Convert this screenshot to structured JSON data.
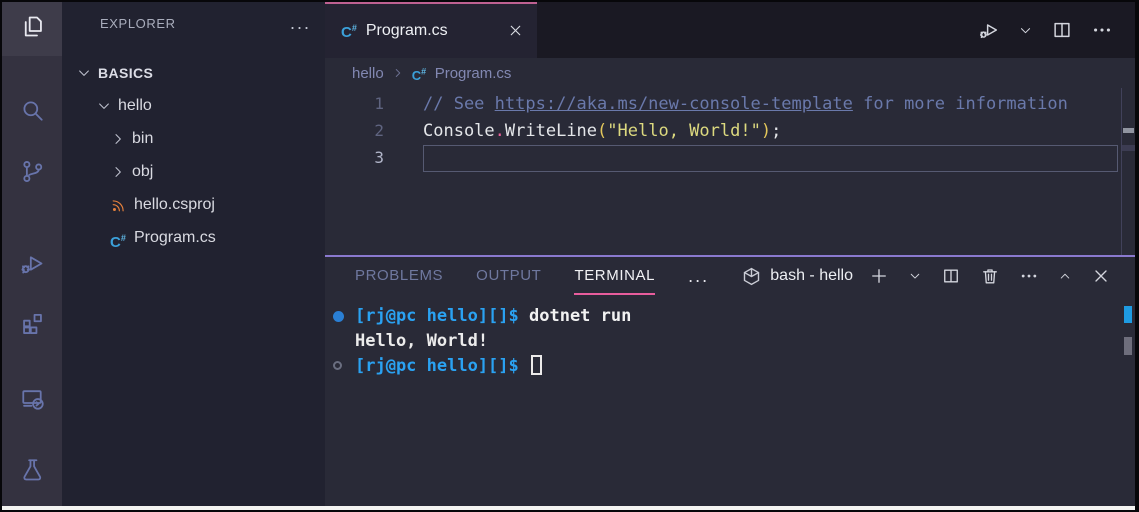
{
  "activity_bar": {
    "items": [
      {
        "name": "explorer",
        "icon": "files",
        "active": true
      },
      {
        "name": "search",
        "icon": "search",
        "active": false
      },
      {
        "name": "source-control",
        "icon": "git",
        "active": false
      },
      {
        "name": "run-and-debug",
        "icon": "debug",
        "active": false
      },
      {
        "name": "extensions",
        "icon": "extensions",
        "active": false
      },
      {
        "name": "remote-explorer",
        "icon": "remote",
        "active": false
      },
      {
        "name": "testing",
        "icon": "beaker",
        "active": false
      }
    ]
  },
  "sidebar": {
    "header": "EXPLORER",
    "more_icon": "...",
    "tree": [
      {
        "label": "BASICS",
        "icon": "chevron-down",
        "level": 0,
        "root": true
      },
      {
        "label": "hello",
        "icon": "chevron-down",
        "level": 1
      },
      {
        "label": "bin",
        "icon": "chevron-right",
        "level": 2
      },
      {
        "label": "obj",
        "icon": "chevron-right",
        "level": 2
      },
      {
        "label": "hello.csproj",
        "icon": "rss",
        "level": 2
      },
      {
        "label": "Program.cs",
        "icon": "csharp",
        "level": 2
      }
    ]
  },
  "editor": {
    "tab": {
      "label": "Program.cs",
      "icon": "csharp"
    },
    "actions": [
      {
        "name": "run-or-debug",
        "icon": "debug"
      },
      {
        "name": "run-dropdown",
        "icon": "chevron-down",
        "small": true
      },
      {
        "name": "split-editor",
        "icon": "split"
      },
      {
        "name": "more-actions",
        "icon": "ellipsis"
      }
    ],
    "breadcrumb": {
      "folder": "hello",
      "file": "Program.cs",
      "file_icon": "csharp"
    },
    "lines": [
      {
        "num": "1",
        "tokens": [
          {
            "text": "// See ",
            "style": "comment"
          },
          {
            "text": "https://aka.ms/new-console-template",
            "style": "comment-link"
          },
          {
            "text": " for more information",
            "style": "comment"
          }
        ]
      },
      {
        "num": "2",
        "tokens": [
          {
            "text": "Console",
            "style": "plain"
          },
          {
            "text": ".",
            "style": "accent-dot"
          },
          {
            "text": "WriteLine",
            "style": "plain"
          },
          {
            "text": "(",
            "style": "paren"
          },
          {
            "text": "\"Hello, World!\"",
            "style": "string"
          },
          {
            "text": ")",
            "style": "paren"
          },
          {
            "text": ";",
            "style": "plain"
          }
        ]
      },
      {
        "num": "3",
        "tokens": [],
        "current": true
      }
    ]
  },
  "panel": {
    "tabs": [
      {
        "label": "PROBLEMS",
        "active": false
      },
      {
        "label": "OUTPUT",
        "active": false
      },
      {
        "label": "TERMINAL",
        "active": true
      }
    ],
    "more_icon": "...",
    "terminal_label": "bash - hello",
    "actions": [
      {
        "name": "new-terminal",
        "icon": "plus"
      },
      {
        "name": "terminal-dropdown",
        "icon": "chevron-down",
        "small": true
      },
      {
        "name": "split-terminal",
        "icon": "split"
      },
      {
        "name": "kill-terminal",
        "icon": "trash"
      },
      {
        "name": "more-actions",
        "icon": "ellipsis"
      },
      {
        "name": "maximize-panel",
        "icon": "chevron-up",
        "small": true
      },
      {
        "name": "close-panel",
        "icon": "close"
      }
    ],
    "terminal_lines": [
      {
        "decoration": "success",
        "tokens": [
          {
            "text": "[rj@pc hello][]$ ",
            "style": "prompt"
          },
          {
            "text": "dotnet run",
            "style": "command"
          }
        ]
      },
      {
        "decoration": "none",
        "tokens": [
          {
            "text": "Hello, World!",
            "style": "output"
          }
        ]
      },
      {
        "decoration": "pending",
        "cursor": true,
        "tokens": [
          {
            "text": "[rj@pc hello][]$ ",
            "style": "prompt"
          }
        ]
      }
    ]
  },
  "colors": {
    "activity_bar_bg": "#343240",
    "sidebar_bg": "#212230",
    "editor_bg": "#292a37",
    "tabbar_bg": "#1a1923",
    "active_tab_top_border": "#bf6192",
    "panel_top_border": "#8a79cf",
    "terminal_tab_underline": "#e85d9d",
    "terminal_prompt_blue": "#2aa2f2",
    "csharp_icon_blue": "#3ba0d9",
    "csproj_icon_orange": "#e8823c",
    "string_yellow": "#dcd97f",
    "comment_blue": "#6a79ab"
  }
}
